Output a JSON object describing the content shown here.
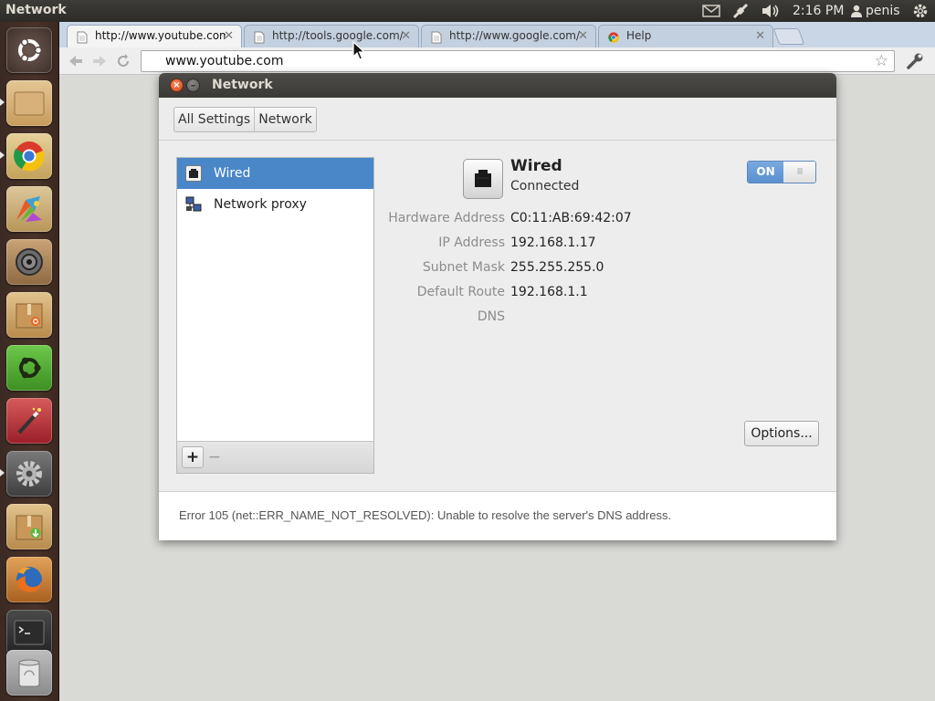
{
  "panel": {
    "app_title": "Network",
    "clock": "2:16 PM",
    "user": "penis"
  },
  "launcher": {
    "items": [
      {
        "name": "dash-home"
      },
      {
        "name": "files"
      },
      {
        "name": "chrome"
      },
      {
        "name": "gimp"
      },
      {
        "name": "speaker-app"
      },
      {
        "name": "ubuntu-software-center"
      },
      {
        "name": "ubuntu-one"
      },
      {
        "name": "paint-app"
      },
      {
        "name": "system-settings"
      },
      {
        "name": "update-manager"
      },
      {
        "name": "firefox"
      },
      {
        "name": "terminal"
      },
      {
        "name": "trash"
      }
    ]
  },
  "browser": {
    "tabs": [
      {
        "label": "http://www.youtube.com/",
        "active": true
      },
      {
        "label": "http://tools.google.com/c",
        "active": false
      },
      {
        "label": "http://www.google.com/se",
        "active": false
      },
      {
        "label": "Help",
        "active": false
      }
    ],
    "url": "www.youtube.com",
    "error_message": "Error 105 (net::ERR_NAME_NOT_RESOLVED): Unable to resolve the server's DNS address."
  },
  "dialog": {
    "title": "Network",
    "breadcrumbs": [
      "All Settings",
      "Network"
    ],
    "list": [
      {
        "label": "Wired",
        "selected": true
      },
      {
        "label": "Network proxy",
        "selected": false
      }
    ],
    "add_label": "+",
    "remove_label": "−",
    "detail": {
      "name": "Wired",
      "status": "Connected",
      "toggle": "ON",
      "toggle_grip": "III",
      "properties": [
        {
          "label": "Hardware Address",
          "value": "C0:11:AB:69:42:07"
        },
        {
          "label": "IP Address",
          "value": "192.168.1.17"
        },
        {
          "label": "Subnet Mask",
          "value": "255.255.255.0"
        },
        {
          "label": "Default Route",
          "value": "192.168.1.1"
        },
        {
          "label": "DNS",
          "value": ""
        }
      ],
      "options_label": "Options..."
    }
  },
  "colors": {
    "selection": "#4a87c8",
    "toggle_on": "#5a8fd0",
    "panel_bg": "#3d3c38",
    "launcher_bg": "#4a3329"
  }
}
